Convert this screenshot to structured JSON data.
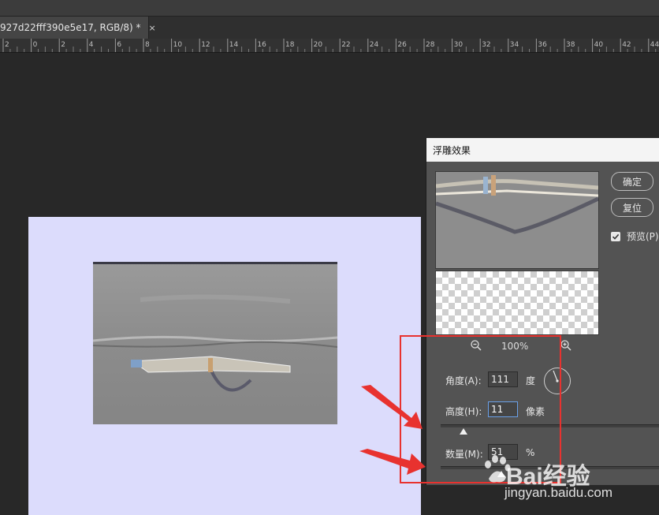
{
  "document": {
    "tab_title": "927d22fff390e5e17, RGB/8) *",
    "close_symbol": "×"
  },
  "ruler": {
    "labels": [
      "2",
      "0",
      "2",
      "4",
      "6",
      "8",
      "10",
      "12",
      "14",
      "16",
      "18",
      "20",
      "22",
      "24",
      "26",
      "28",
      "30",
      "32",
      "34",
      "36",
      "38",
      "40",
      "42",
      "44"
    ]
  },
  "dialog": {
    "title": "浮雕效果",
    "ok_label": "确定",
    "reset_label": "复位",
    "preview_label": "预览(P)",
    "preview_checked": true,
    "zoom_value": "100%",
    "angle": {
      "label": "角度(A):",
      "value": "111",
      "unit": "度"
    },
    "height": {
      "label": "高度(H):",
      "value": "11",
      "unit": "像素"
    },
    "amount": {
      "label": "数量(M):",
      "value": "51",
      "unit": "%"
    }
  },
  "watermark": {
    "logo": "Bai",
    "logo_suffix": "经验",
    "url": "jingyan.baidu.com"
  },
  "colors": {
    "canvas_bg": "#dcdcfc",
    "annotation": "#e8322f",
    "dialog_bg": "#535353",
    "app_bg": "#282828"
  }
}
